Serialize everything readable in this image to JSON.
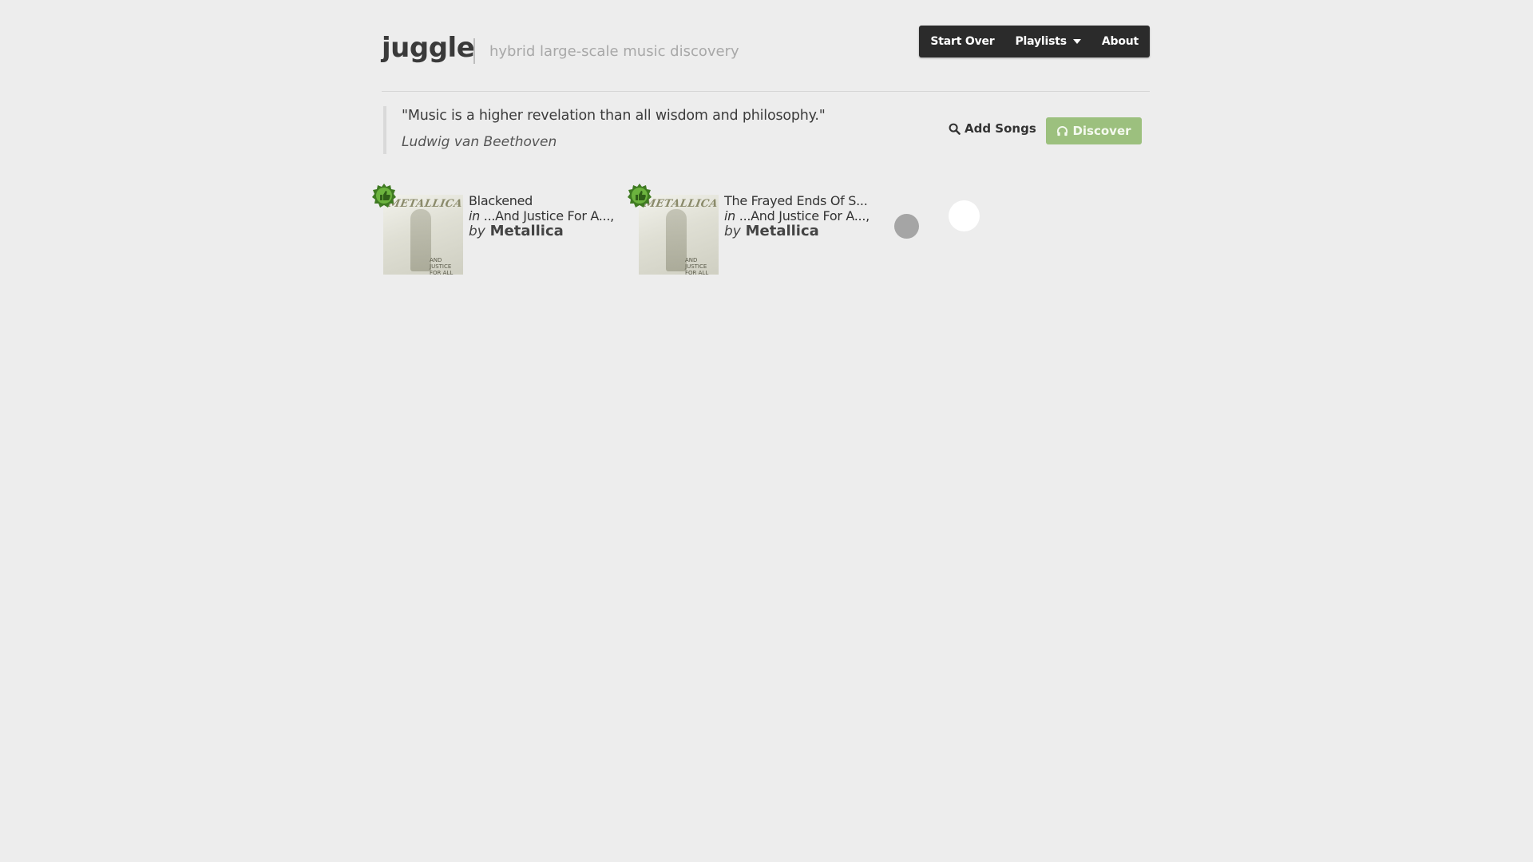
{
  "header": {
    "brand": "juggle",
    "tagline": "hybrid large-scale music discovery",
    "nav": {
      "start_over": "Start Over",
      "playlists": "Playlists",
      "about": "About"
    }
  },
  "quote": {
    "text": "\"Music is a higher revelation than all wisdom and philosophy.\"",
    "author": "Ludwig van Beethoven"
  },
  "actions": {
    "add_songs": "Add Songs",
    "discover": "Discover"
  },
  "songs": [
    {
      "title": "Blackened",
      "in_label": "in",
      "album": "...And Justice For A...,",
      "by_label": "by",
      "artist": "Metallica",
      "cover_logo": "METALLICA",
      "cover_sub": "AND JUSTICE FOR ALL"
    },
    {
      "title": "The Frayed Ends Of S...",
      "in_label": "in",
      "album": "...And Justice For A...,",
      "by_label": "by",
      "artist": "Metallica",
      "cover_logo": "METALLICA",
      "cover_sub": "AND JUSTICE FOR ALL"
    }
  ],
  "colors": {
    "background": "#ededed",
    "navbar": "#2b2b2b",
    "discover": "#9cc07e",
    "like_badge": "#4f8f2a"
  },
  "icons": {
    "add_songs": "search-icon",
    "discover": "headphones-icon",
    "like": "thumbs-up-icon",
    "playlists": "caret-down-icon"
  }
}
